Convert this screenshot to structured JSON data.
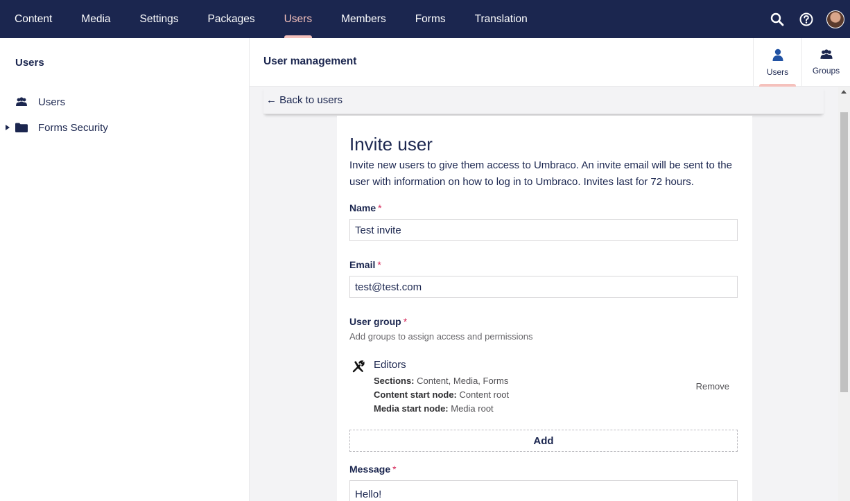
{
  "topnav": {
    "items": [
      {
        "label": "Content"
      },
      {
        "label": "Media"
      },
      {
        "label": "Settings"
      },
      {
        "label": "Packages"
      },
      {
        "label": "Users"
      },
      {
        "label": "Members"
      },
      {
        "label": "Forms"
      },
      {
        "label": "Translation"
      }
    ],
    "active": "Users",
    "icons": [
      "search-icon",
      "help-icon",
      "avatar"
    ]
  },
  "sidebar": {
    "title": "Users",
    "items": [
      {
        "label": "Users",
        "icon": "users-icon"
      },
      {
        "label": "Forms Security",
        "icon": "folder-icon",
        "expandable": true
      }
    ]
  },
  "header": {
    "title": "User management",
    "tabs": [
      {
        "label": "Users",
        "icon": "user-icon",
        "active": true
      },
      {
        "label": "Groups",
        "icon": "users-icon",
        "active": false
      }
    ]
  },
  "subheader": {
    "back_label": "← Back to users"
  },
  "form": {
    "title": "Invite user",
    "description": "Invite new users to give them access to Umbraco. An invite email will be sent to the user with information on how to log in to Umbraco. Invites last for 72 hours.",
    "required_marker": "*",
    "name": {
      "label": "Name",
      "value": "Test invite"
    },
    "email": {
      "label": "Email",
      "value": "test@test.com"
    },
    "user_group": {
      "label": "User group",
      "hint": "Add groups to assign access and permissions",
      "groups": [
        {
          "name": "Editors",
          "icon": "tools-icon",
          "sections_label": "Sections:",
          "sections_value": "Content, Media, Forms",
          "content_start_label": "Content start node:",
          "content_start_value": "Content root",
          "media_start_label": "Media start node:",
          "media_start_value": "Media root",
          "remove_label": "Remove"
        }
      ],
      "add_label": "Add"
    },
    "message": {
      "label": "Message",
      "value": "Hello!"
    }
  },
  "colors": {
    "nav_bg": "#1b264f",
    "accent": "#f5c1bc",
    "required": "#d42054",
    "main_bg": "#f3f3f5"
  }
}
